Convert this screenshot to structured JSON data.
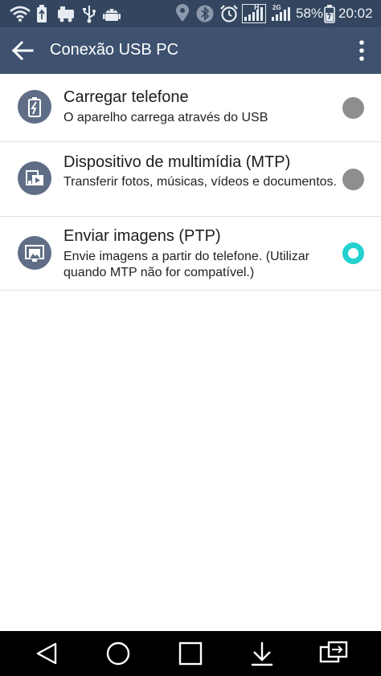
{
  "status_bar": {
    "battery_percent": "58%",
    "time": "20:02",
    "network_1": "H",
    "network_2": "2G",
    "icons": [
      "wifi-icon",
      "usb-battery-icon",
      "train-icon",
      "usb-icon",
      "android-icon",
      "location-icon",
      "bluetooth-icon",
      "alarm-icon",
      "signal-icon",
      "signal-icon",
      "battery-charging-icon"
    ]
  },
  "app_bar": {
    "title": "Conexão USB PC",
    "back_icon": "arrow-left-icon",
    "menu_icon": "more-vertical-icon"
  },
  "options": [
    {
      "title": "Carregar telefone",
      "desc": "O aparelho carrega através do USB",
      "icon": "battery-charge-icon",
      "selected": false
    },
    {
      "title": "Dispositivo de multimídia (MTP)",
      "desc": "Transferir fotos, músicas, vídeos e documentos.",
      "icon": "media-device-icon",
      "selected": false
    },
    {
      "title": "Enviar imagens (PTP)",
      "desc": "Envie imagens a partir do telefone. (Utilizar quando MTP não for compatível.)",
      "icon": "picture-transfer-icon",
      "selected": true
    }
  ],
  "colors": {
    "status_bar": "#34465f",
    "app_bar": "#3e5270",
    "accent": "#23d2cf",
    "radio_off": "#8e8e8e",
    "icon_circle": "#5f6e86"
  },
  "nav_bar": {
    "icons": [
      "back-triangle-icon",
      "home-circle-icon",
      "recents-square-icon",
      "notification-down-icon",
      "dual-window-icon"
    ]
  }
}
